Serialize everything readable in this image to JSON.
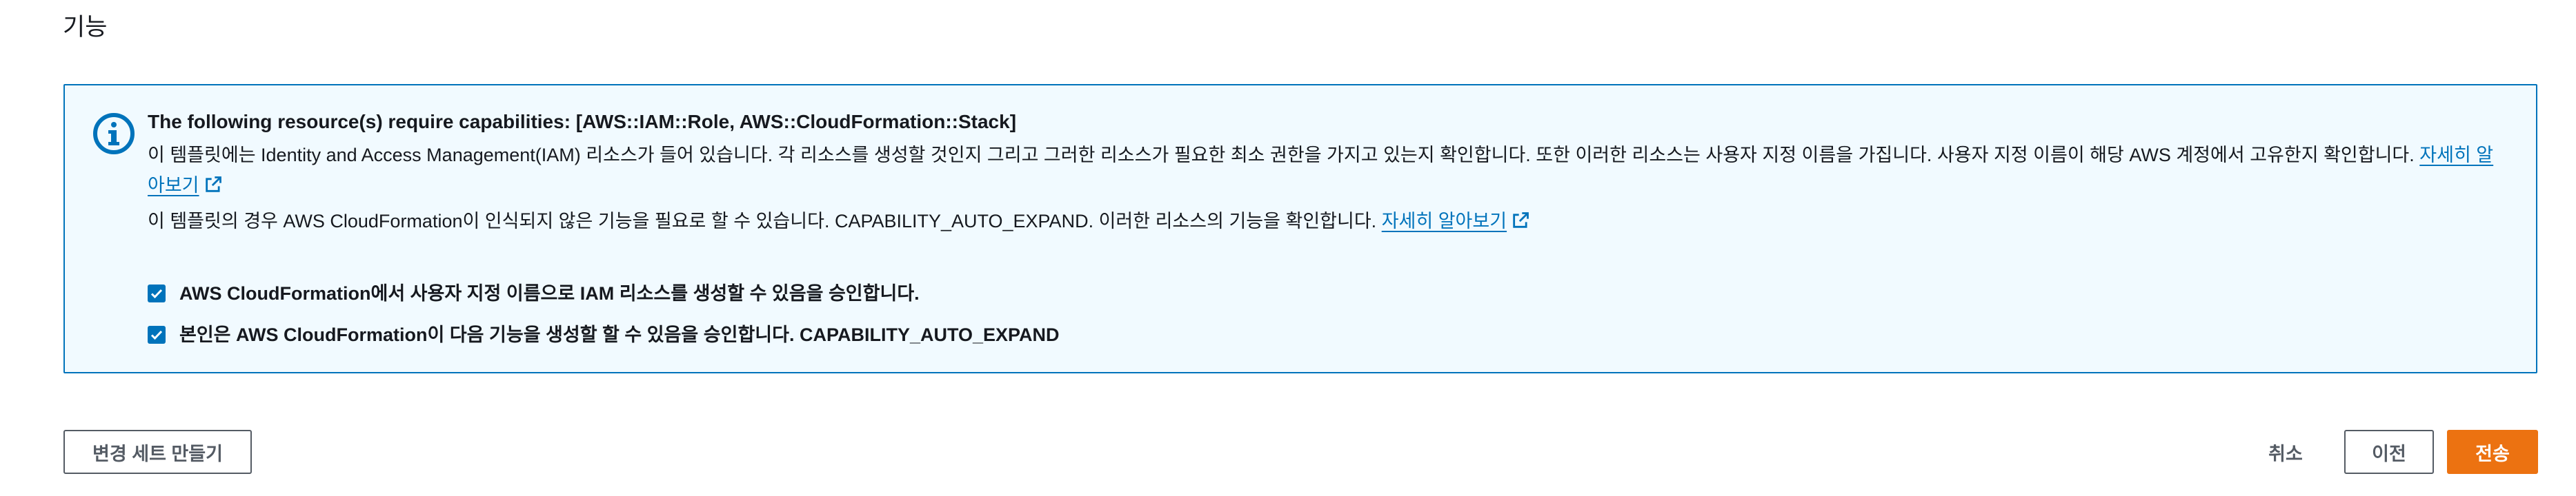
{
  "section": {
    "title": "기능"
  },
  "alert": {
    "heading": "The following resource(s) require capabilities: [AWS::IAM::Role, AWS::CloudFormation::Stack]",
    "para1_text": "이 템플릿에는 Identity and Access Management(IAM) 리소스가 들어 있습니다. 각 리소스를 생성할 것인지 그리고 그러한 리소스가 필요한 최소 권한을 가지고 있는지 확인합니다. 또한 이러한 리소스는 사용자 지정 이름을 가집니다. 사용자 지정 이름이 해당 AWS 계정에서 고유한지 확인합니다. ",
    "para1_link": "자세히 알아보기",
    "para2_text": "이 템플릿의 경우 AWS CloudFormation이 인식되지 않은 기능을 필요로 할 수 있습니다. CAPABILITY_AUTO_EXPAND. 이러한 리소스의 기능을 확인합니다. ",
    "para2_link": "자세히 알아보기",
    "colors": {
      "border": "#0073bb",
      "background": "#f1faff"
    }
  },
  "acknowledgements": [
    {
      "label": "AWS CloudFormation에서 사용자 지정 이름으로 IAM 리소스를 생성할 수 있음을 승인합니다.",
      "checked": true
    },
    {
      "label": "본인은 AWS CloudFormation이 다음 기능을 생성할 할 수 있음을 승인합니다. CAPABILITY_AUTO_EXPAND",
      "checked": true
    }
  ],
  "footer": {
    "create_change_set": "변경 세트 만들기",
    "cancel": "취소",
    "previous": "이전",
    "submit": "전송",
    "primary_color": "#ec7211"
  },
  "icons": {
    "alert": "info-icon",
    "link": "external-link-icon",
    "checkbox": "check-icon"
  }
}
